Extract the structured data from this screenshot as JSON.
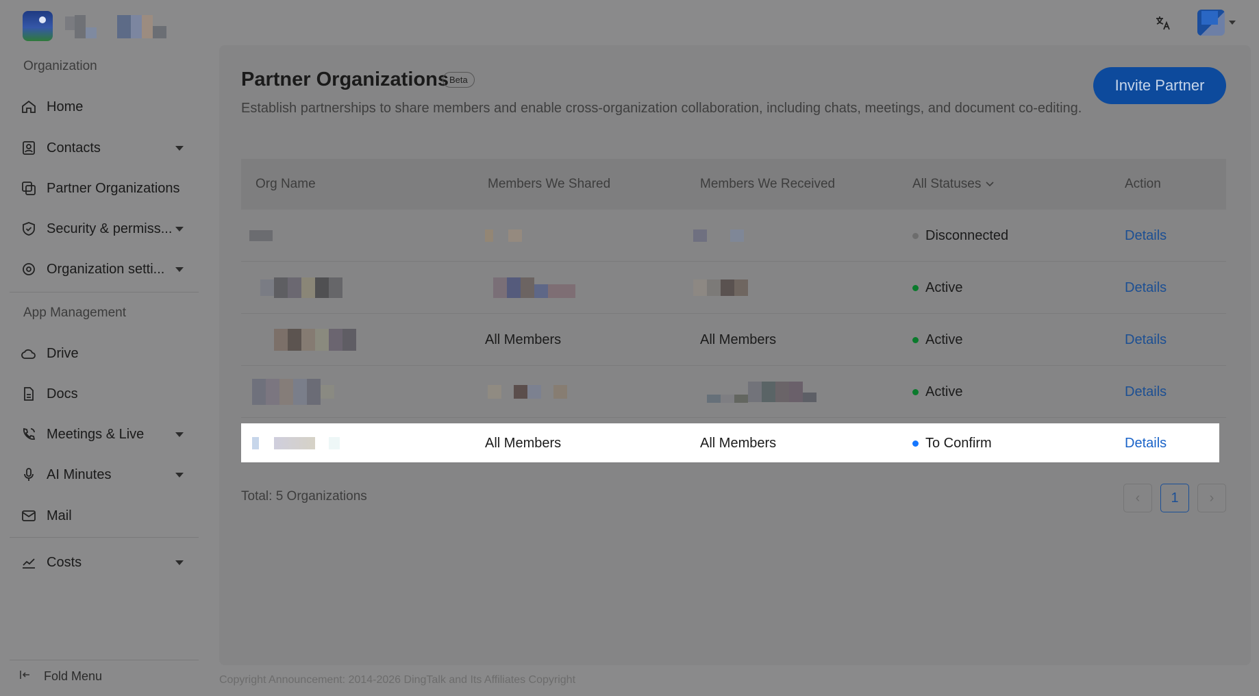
{
  "sidebar": {
    "section_organization": "Organization",
    "section_app_management": "App Management",
    "items": [
      {
        "label": "Home"
      },
      {
        "label": "Contacts"
      },
      {
        "label": "Partner Organizations"
      },
      {
        "label": "Security & permiss..."
      },
      {
        "label": "Organization setti..."
      },
      {
        "label": "Drive"
      },
      {
        "label": "Docs"
      },
      {
        "label": "Meetings & Live"
      },
      {
        "label": "AI Minutes"
      },
      {
        "label": "Mail"
      },
      {
        "label": "Costs"
      }
    ],
    "fold_menu": "Fold Menu"
  },
  "page": {
    "title": "Partner Organizations",
    "badge": "Beta",
    "description": "Establish partnerships to share members and enable cross-organization collaboration, including chats, meetings, and document co-editing.",
    "invite_button": "Invite Partner"
  },
  "table": {
    "headers": {
      "org_name": "Org Name",
      "members_shared": "Members We Shared",
      "members_received": "Members We Received",
      "status_filter": "All Statuses",
      "action": "Action"
    },
    "rows": [
      {
        "shared": "",
        "received": "",
        "status": "Disconnected",
        "status_color": "#6d6d6d",
        "action": "Details"
      },
      {
        "shared": "",
        "received": "",
        "status": "Active",
        "status_color": "#0a7a2c",
        "action": "Details"
      },
      {
        "shared": "All Members",
        "received": "All Members",
        "status": "Active",
        "status_color": "#0a7a2c",
        "action": "Details"
      },
      {
        "shared": "",
        "received": "",
        "status": "Active",
        "status_color": "#0a7a2c",
        "action": "Details"
      },
      {
        "shared": "All Members",
        "received": "All Members",
        "status": "To Confirm",
        "status_color": "#1677ff",
        "action": "Details"
      }
    ]
  },
  "footer": {
    "total": "Total: 5 Organizations",
    "current_page": "1",
    "prev_symbol": "‹",
    "next_symbol": "›"
  },
  "copyright": "Copyright Announcement: 2014-2026 DingTalk and Its Affiliates Copyright"
}
